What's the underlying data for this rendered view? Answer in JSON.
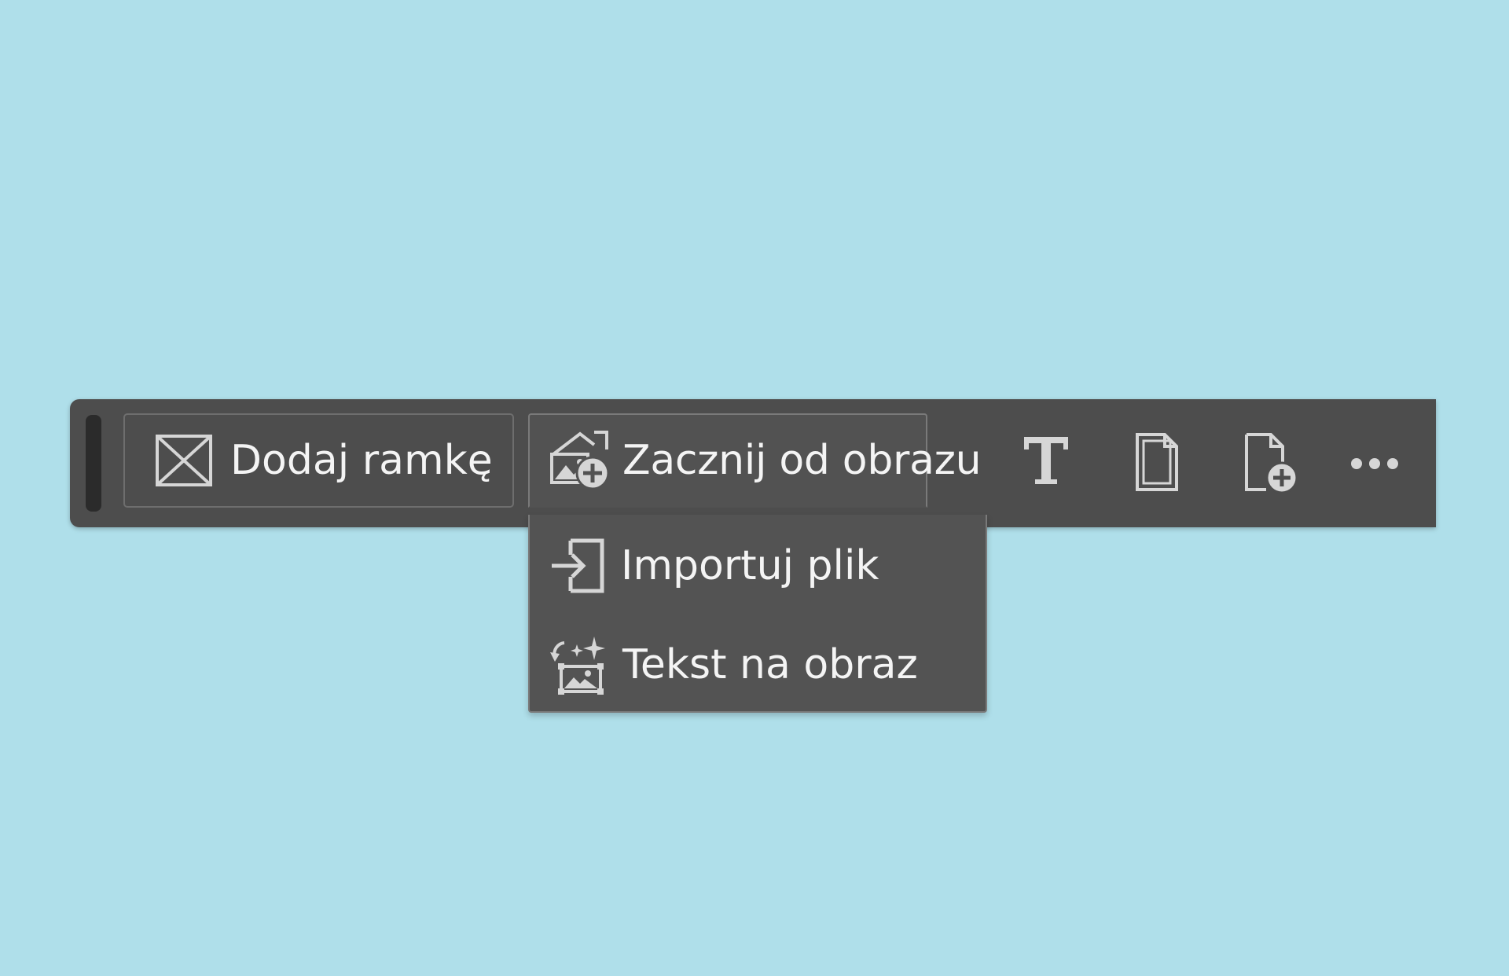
{
  "toolbar": {
    "add_frame_label": "Dodaj ramkę",
    "start_from_image_label": "Zacznij od obrazu",
    "tools": [
      {
        "name": "text-tool",
        "icon": "text-icon"
      },
      {
        "name": "page-tool",
        "icon": "page-icon"
      },
      {
        "name": "add-page-tool",
        "icon": "add-page-icon"
      },
      {
        "name": "more-tool",
        "icon": "more-icon"
      }
    ]
  },
  "dropdown": {
    "items": [
      {
        "label": "Importuj plik",
        "icon": "import-icon"
      },
      {
        "label": "Tekst na obraz",
        "icon": "text-to-image-icon"
      }
    ]
  },
  "colors": {
    "background": "#afdfea",
    "toolbar": "#4d4d4d",
    "text": "#f4f4f4",
    "border": "#6e6e6e"
  }
}
